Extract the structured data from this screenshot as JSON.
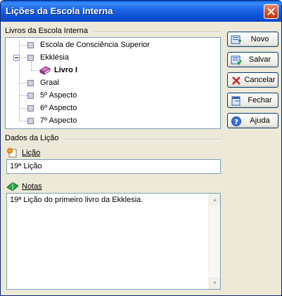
{
  "window": {
    "title": "Lições da Escola Interna"
  },
  "tree_group": {
    "label": "Livros da Escola Interna",
    "items": [
      {
        "label": "Escola de Consciência Superior"
      },
      {
        "label": "Ekklésia"
      },
      {
        "label": "Livro I"
      },
      {
        "label": "Graal"
      },
      {
        "label": "5º Aspecto"
      },
      {
        "label": "6º Aspecto"
      },
      {
        "label": "7º Aspecto"
      }
    ]
  },
  "details_group": {
    "label": "Dados da Lição"
  },
  "licao": {
    "label": "Lição",
    "value": "19ª Lição"
  },
  "notas": {
    "label": "Notas",
    "value": "19ª Lição do primeiro livro da Ekklesia."
  },
  "buttons": {
    "novo": "Novo",
    "salvar": "Salvar",
    "cancelar": "Cancelar",
    "fechar": "Fechar",
    "ajuda": "Ajuda"
  }
}
